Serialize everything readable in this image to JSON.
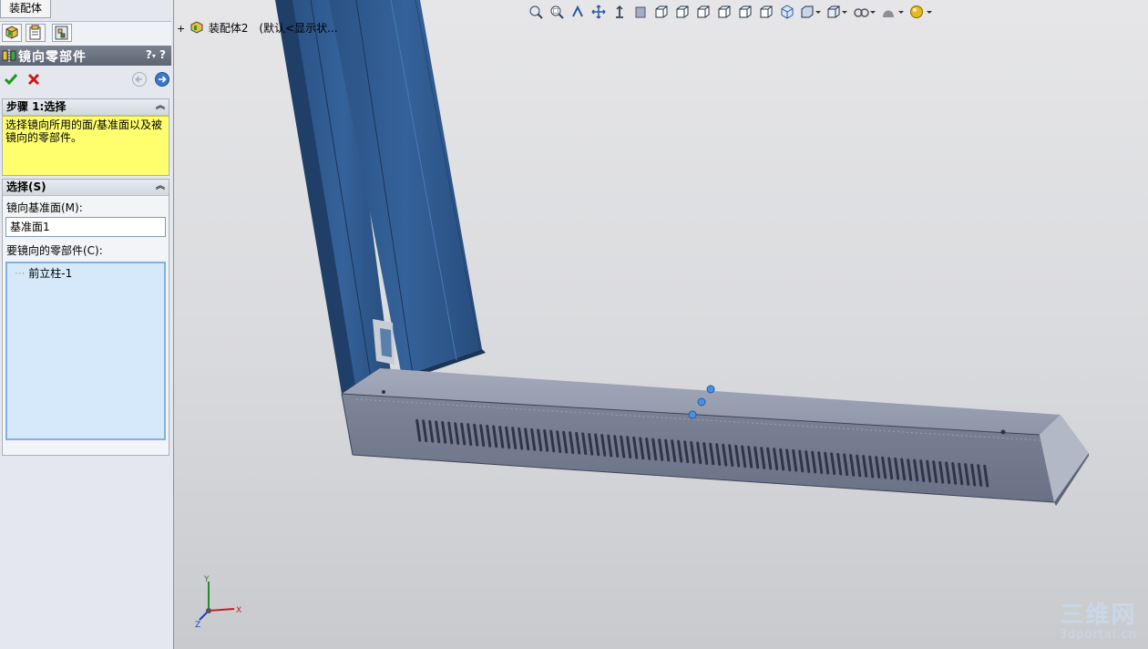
{
  "top_tab": "装配体",
  "property_manager": {
    "title": "镜向零部件",
    "help": "?",
    "step_group": {
      "title": "步骤 1:选择",
      "message": "选择镜向所用的面/基准面以及被镜向的零部件。"
    },
    "selection_group": {
      "title": "选择(S)",
      "mirror_plane_label": "镜向基准面(M):",
      "mirror_plane_value": "基准面1",
      "components_label": "要镜向的零部件(C):",
      "components": [
        "前立柱-1"
      ]
    }
  },
  "tree": {
    "expand": "+",
    "assembly": "装配体2",
    "config": "(默认<显示状..."
  },
  "triad": {
    "x": "X",
    "y": "Y",
    "z": "Z"
  },
  "watermark": {
    "line1": "三维网",
    "line2": "3dportal.cn"
  },
  "colors": {
    "accent_blue": "#2c5a8f",
    "message_yellow": "#ffff6e",
    "ok_green": "#1a9a1a",
    "cancel_red": "#d01818"
  }
}
